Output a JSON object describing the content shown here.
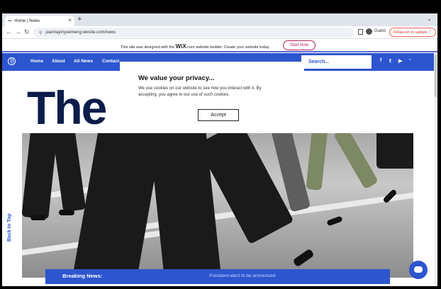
{
  "browser": {
    "tab_title": "Home | News",
    "tab_favicon": "•••",
    "url": "joannayinyuemeng.wixsite.com/news",
    "profile": "Guest",
    "relaunch_label": "Relaunch to update"
  },
  "wix_banner": {
    "text_before": "This site was designed with the ",
    "brand": "WiX",
    "text_after": ".com website builder. Create your website today.",
    "cta": "Start Now"
  },
  "site_nav": {
    "items": [
      "Home",
      "About",
      "All News",
      "Contact"
    ],
    "search_placeholder": "Search...",
    "social": [
      "f",
      "t",
      "▶",
      "rss"
    ]
  },
  "hero": {
    "title": "The"
  },
  "privacy": {
    "title": "We value your privacy...",
    "body": "We use cookies on our website to see how you interact with it. By accepting, you agree to our use of such cookies.",
    "accept": "Accept"
  },
  "back_to_top": "Back to Top",
  "breaking": {
    "label": "Breaking News:",
    "text": "President-elect to be announced"
  },
  "colors": {
    "accent": "#2c55cf",
    "title": "#0b1d4a",
    "cta": "#b0245e"
  }
}
